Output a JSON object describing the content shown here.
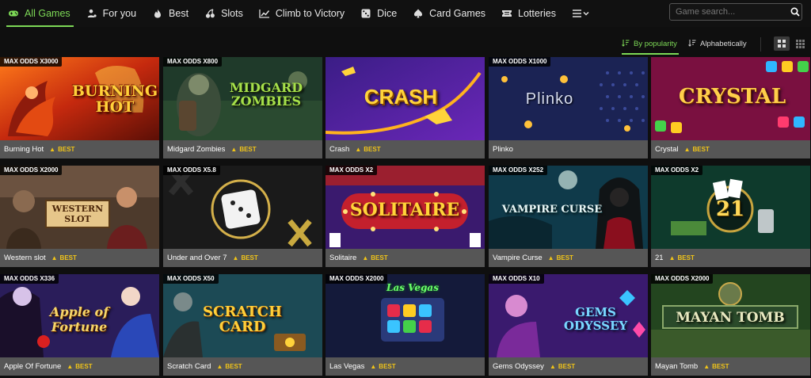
{
  "nav": {
    "items": [
      {
        "label": "All Games",
        "icon": "gamepad-icon",
        "active": true
      },
      {
        "label": "For you",
        "icon": "user-icon"
      },
      {
        "label": "Best",
        "icon": "flame-icon"
      },
      {
        "label": "Slots",
        "icon": "cherries-icon"
      },
      {
        "label": "Climb to Victory",
        "icon": "chart-line-icon"
      },
      {
        "label": "Dice",
        "icon": "dice-icon"
      },
      {
        "label": "Card Games",
        "icon": "spade-icon"
      },
      {
        "label": "Lotteries",
        "icon": "ticket-icon"
      }
    ],
    "more_icon": "menu-more-icon"
  },
  "search": {
    "placeholder": "Game search..."
  },
  "sort": {
    "popularity": "By popularity",
    "alphabetical": "Alphabetically",
    "active": "popularity"
  },
  "view": {
    "active": "large-grid"
  },
  "colors": {
    "accent": "#7dd956",
    "best": "#f0c419",
    "caption_bg": "#565656"
  },
  "badge_label": "BEST",
  "games": [
    {
      "title": "Burning Hot",
      "odds": "MAX ODDS X3000",
      "best": true,
      "logo": "BURNING HOT"
    },
    {
      "title": "Midgard Zombies",
      "odds": "MAX ODDS X800",
      "best": true,
      "logo": "MIDGARD ZOMBIES"
    },
    {
      "title": "Crash",
      "odds": "",
      "best": true,
      "logo": "CRASH"
    },
    {
      "title": "Plinko",
      "odds": "MAX ODDS X1000",
      "best": false,
      "logo": "Plinko"
    },
    {
      "title": "Crystal",
      "odds": "",
      "best": true,
      "logo": "CRYSTAL"
    },
    {
      "title": "Western slot",
      "odds": "MAX ODDS X2000",
      "best": true,
      "logo": "WESTERN SLOT"
    },
    {
      "title": "Under and Over 7",
      "odds": "MAX ODDS X5.8",
      "best": true,
      "logo": ""
    },
    {
      "title": "Solitaire",
      "odds": "MAX ODDS X2",
      "best": true,
      "logo": "SOLITAIRE"
    },
    {
      "title": "Vampire Curse",
      "odds": "MAX ODDS X252",
      "best": true,
      "logo": "VAMPIRE CURSE"
    },
    {
      "title": "21",
      "odds": "MAX ODDS X2",
      "best": true,
      "logo": "21"
    },
    {
      "title": "Apple Of Fortune",
      "odds": "MAX ODDS X336",
      "best": true,
      "logo": "Apple of Fortune"
    },
    {
      "title": "Scratch Card",
      "odds": "MAX ODDS X50",
      "best": true,
      "logo": "SCRATCH CARD"
    },
    {
      "title": "Las Vegas",
      "odds": "MAX ODDS X2000",
      "best": true,
      "logo": "Las Vegas"
    },
    {
      "title": "Gems Odyssey",
      "odds": "MAX ODDS X10",
      "best": true,
      "logo": "GEMS ODYSSEY"
    },
    {
      "title": "Mayan Tomb",
      "odds": "MAX ODDS X2000",
      "best": true,
      "logo": "MAYAN TOMB"
    }
  ]
}
